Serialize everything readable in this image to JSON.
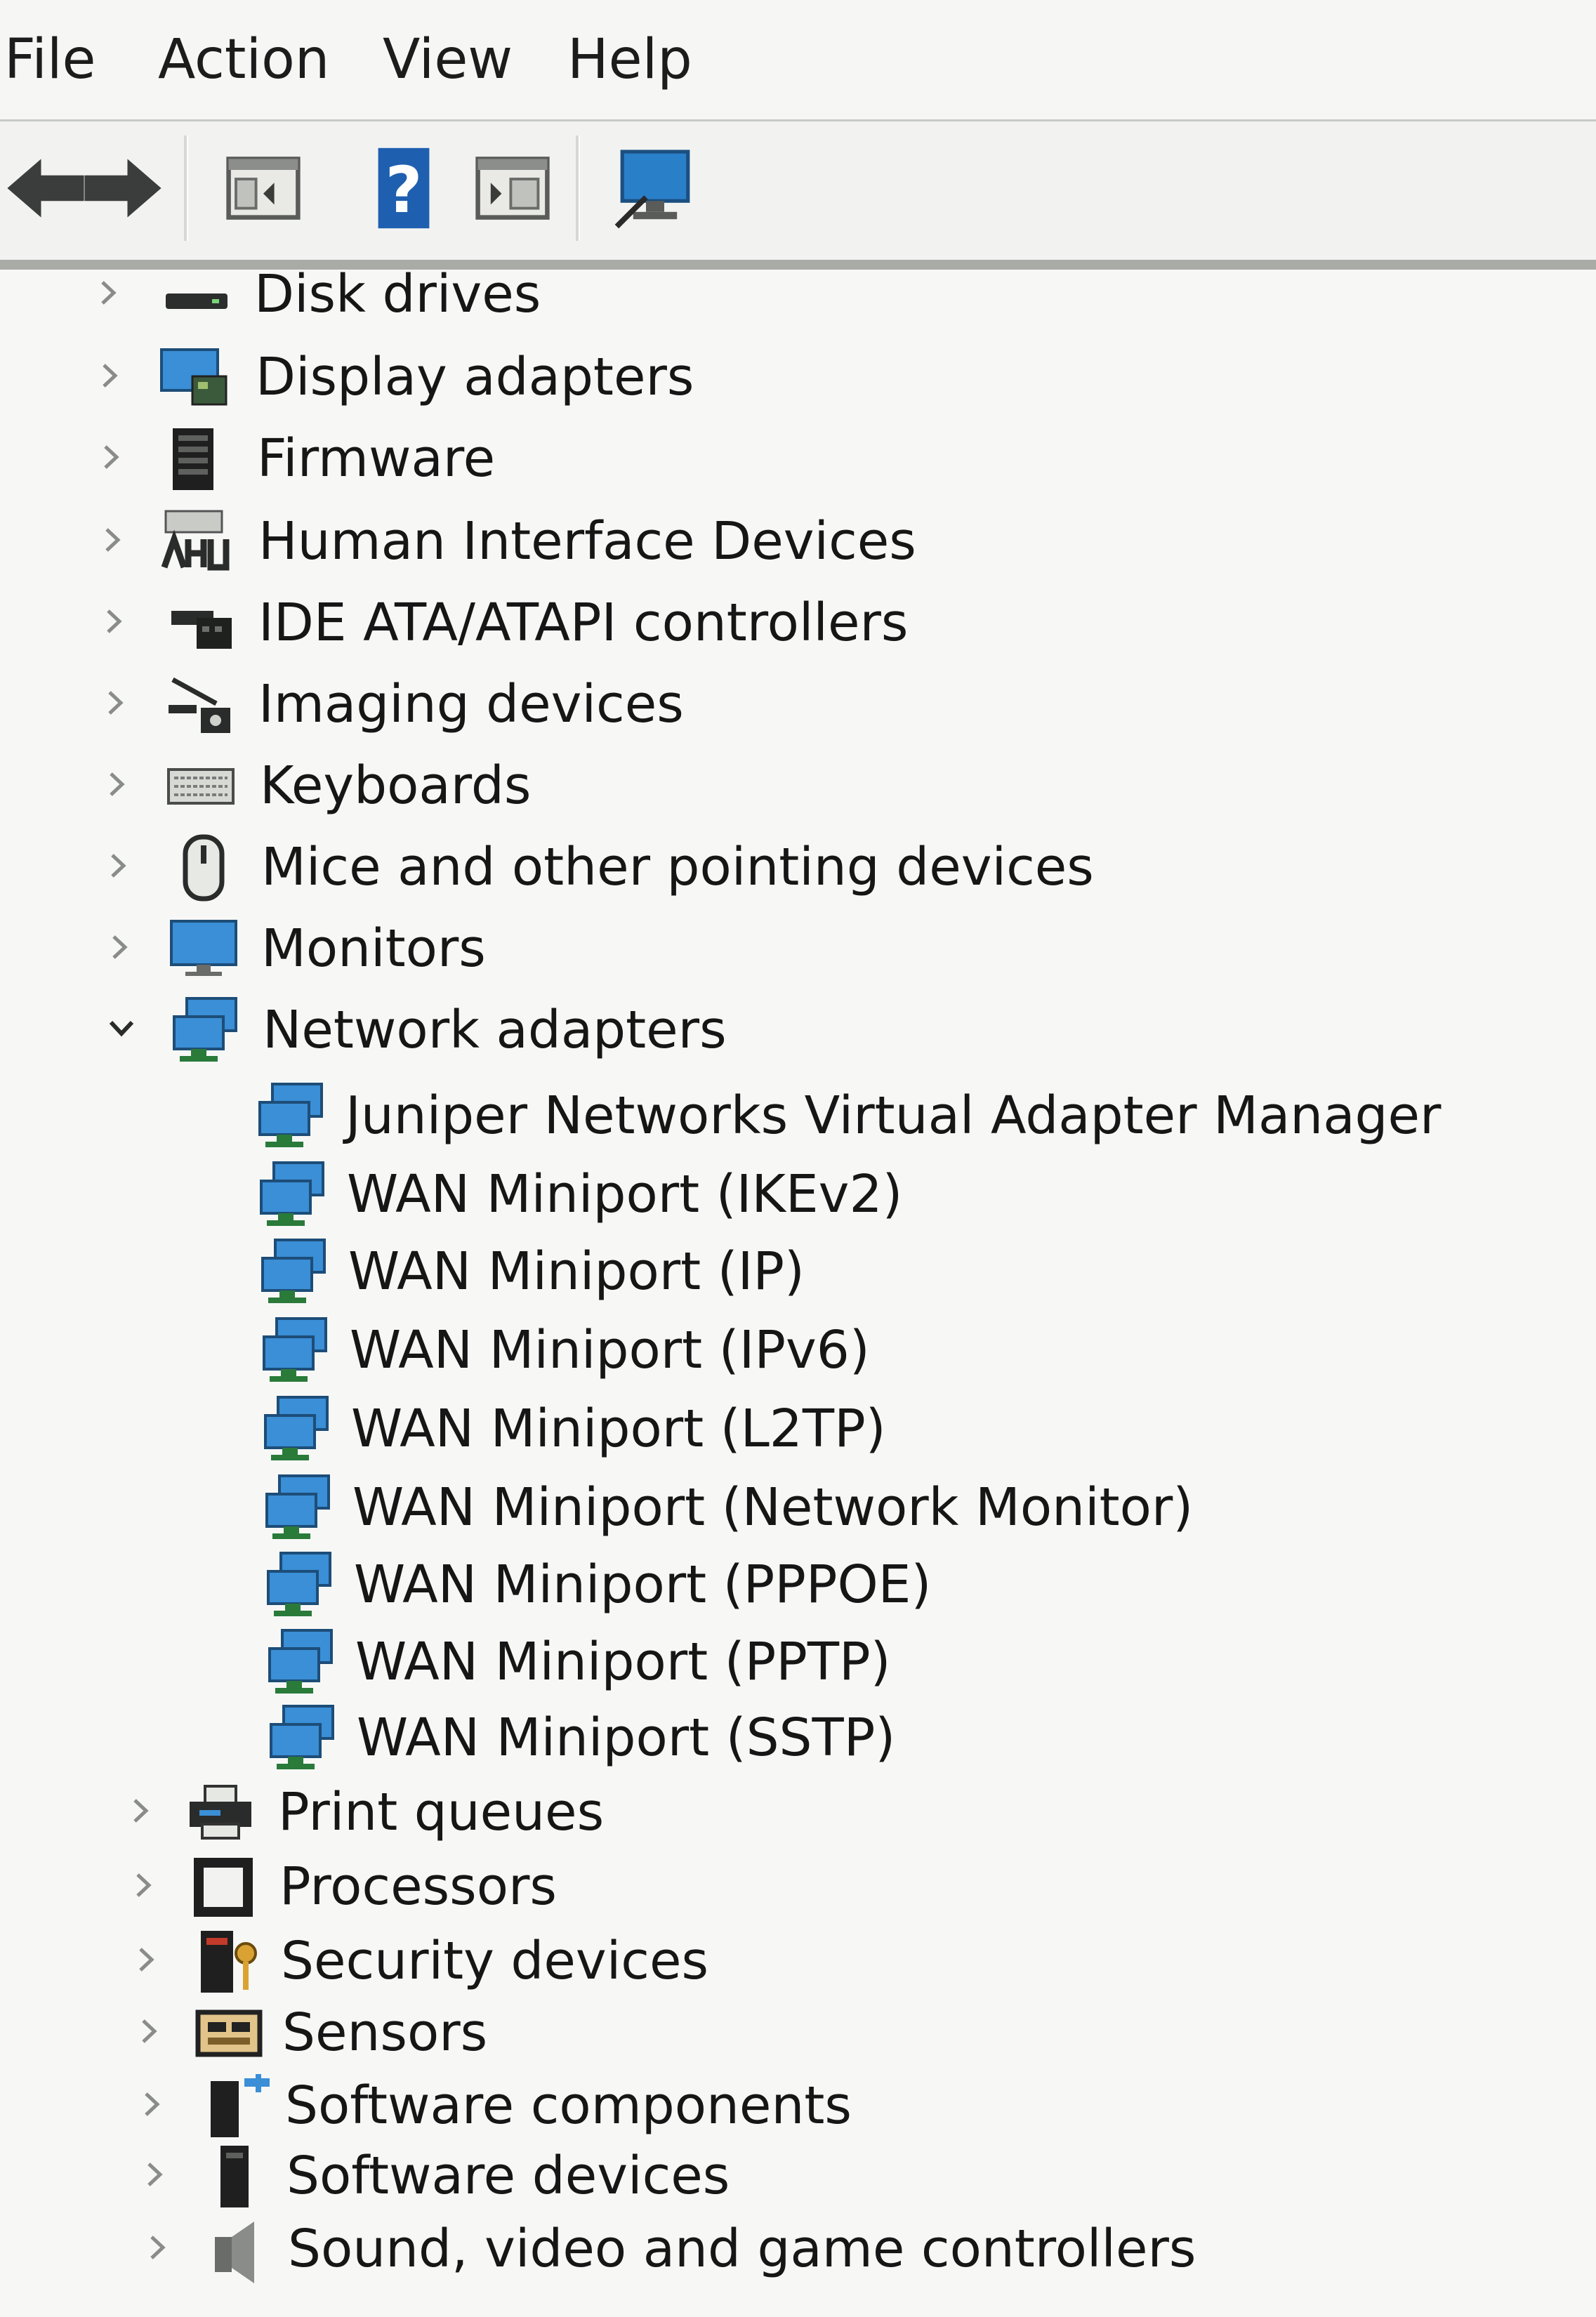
{
  "menu": {
    "items": [
      "File",
      "Action",
      "View",
      "Help"
    ]
  },
  "toolbar": {
    "buttons": [
      "back-icon",
      "forward-icon",
      "show-hide-console-tree-icon",
      "help-icon",
      "action-pane-icon",
      "scan-hardware-monitor-icon"
    ]
  },
  "tree": {
    "categories_before": [
      {
        "label": "Disk drives",
        "icon": "disk-drive-icon",
        "expanded": false
      },
      {
        "label": "Display adapters",
        "icon": "display-adapter-icon",
        "expanded": false
      },
      {
        "label": "Firmware",
        "icon": "firmware-icon",
        "expanded": false
      },
      {
        "label": "Human Interface Devices",
        "icon": "hid-icon",
        "expanded": false
      },
      {
        "label": "IDE ATA/ATAPI controllers",
        "icon": "ide-controller-icon",
        "expanded": false
      },
      {
        "label": "Imaging devices",
        "icon": "imaging-device-icon",
        "expanded": false
      },
      {
        "label": "Keyboards",
        "icon": "keyboard-icon",
        "expanded": false
      },
      {
        "label": "Mice and other pointing devices",
        "icon": "mouse-icon",
        "expanded": false
      },
      {
        "label": "Monitors",
        "icon": "monitor-icon",
        "expanded": false
      }
    ],
    "network": {
      "label": "Network adapters",
      "icon": "network-adapter-icon",
      "expanded": true,
      "children": [
        "Juniper Networks Virtual Adapter Manager",
        "WAN Miniport (IKEv2)",
        "WAN Miniport (IP)",
        "WAN Miniport (IPv6)",
        "WAN Miniport (L2TP)",
        "WAN Miniport (Network Monitor)",
        "WAN Miniport (PPPOE)",
        "WAN Miniport (PPTP)",
        "WAN Miniport (SSTP)"
      ]
    },
    "categories_after": [
      {
        "label": "Print queues",
        "icon": "printer-icon",
        "expanded": false
      },
      {
        "label": "Processors",
        "icon": "processor-icon",
        "expanded": false
      },
      {
        "label": "Security devices",
        "icon": "security-device-icon",
        "expanded": false
      },
      {
        "label": "Sensors",
        "icon": "sensor-icon",
        "expanded": false
      },
      {
        "label": "Software components",
        "icon": "software-component-icon",
        "expanded": false
      },
      {
        "label": "Software devices",
        "icon": "software-device-icon",
        "expanded": false
      },
      {
        "label": "Sound, video and game controllers",
        "icon": "sound-controller-icon",
        "expanded": false
      }
    ]
  },
  "colors": {
    "accent_blue": "#2a7fc9",
    "monitor_screen": "#3a8fd6",
    "help_blue": "#1f5fb0"
  }
}
